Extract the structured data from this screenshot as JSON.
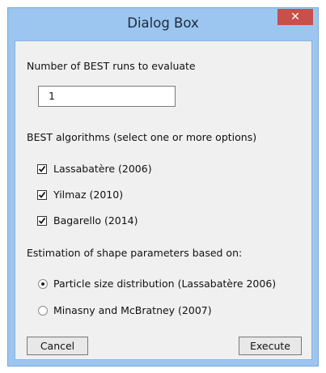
{
  "window": {
    "title": "Dialog Box",
    "close_glyph": "✕"
  },
  "runs": {
    "label": "Number of BEST runs to evaluate",
    "value": "1"
  },
  "algorithms": {
    "label": "BEST algorithms (select one or more options)",
    "options": [
      {
        "label": "Lassabatère (2006)",
        "checked": true
      },
      {
        "label": "Yilmaz (2010)",
        "checked": true
      },
      {
        "label": "Bagarello (2014)",
        "checked": true
      }
    ]
  },
  "shape": {
    "label": "Estimation of shape parameters based on:",
    "options": [
      {
        "label": "Particle size distribution (Lassabatère 2006)",
        "selected": true
      },
      {
        "label": "Minasny and McBratney (2007)",
        "selected": false
      }
    ]
  },
  "buttons": {
    "cancel": "Cancel",
    "execute": "Execute"
  },
  "icons": {
    "checkmark": "checkmark-icon",
    "close": "close-icon"
  }
}
